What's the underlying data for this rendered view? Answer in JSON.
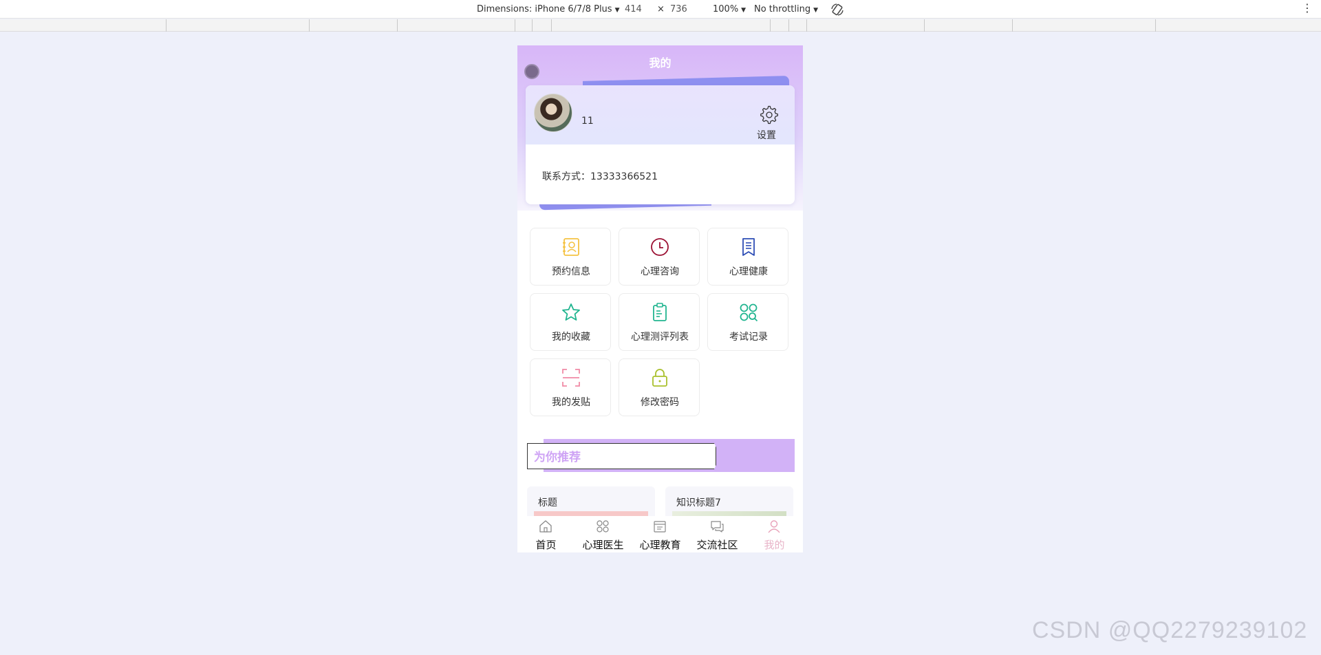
{
  "devtools": {
    "dimensions_label": "Dimensions: iPhone 6/7/8 Plus",
    "width": "414",
    "times": "×",
    "height": "736",
    "zoom": "100%",
    "throttling": "No throttling",
    "rotate_icon": "rotate-icon",
    "more_icon": "kebab-icon"
  },
  "page": {
    "title": "我的"
  },
  "profile": {
    "username": "11",
    "settings_label": "设置",
    "contact_label": "联系方式：13333366521"
  },
  "menu": [
    {
      "label": "预约信息",
      "icon": "contact-book-icon",
      "color": "#f5c242"
    },
    {
      "label": "心理咨询",
      "icon": "clock-icon",
      "color": "#9b1032"
    },
    {
      "label": "心理健康",
      "icon": "bookmark-list-icon",
      "color": "#2d4db5"
    },
    {
      "label": "我的收藏",
      "icon": "star-icon",
      "color": "#22b590"
    },
    {
      "label": "心理测评列表",
      "icon": "clipboard-icon",
      "color": "#22b590"
    },
    {
      "label": "考试记录",
      "icon": "apps-search-icon",
      "color": "#22b590"
    },
    {
      "label": "我的发贴",
      "icon": "scan-icon",
      "color": "#f08aa6"
    },
    {
      "label": "修改密码",
      "icon": "lock-icon",
      "color": "#a9c02d"
    }
  ],
  "recommend": {
    "title": "为你推荐",
    "cards": [
      {
        "title": "标题"
      },
      {
        "title": "知识标题7"
      }
    ]
  },
  "tabbar": [
    {
      "label": "首页",
      "icon": "home-icon"
    },
    {
      "label": "心理医生",
      "icon": "grid-icon"
    },
    {
      "label": "心理教育",
      "icon": "calendar-icon"
    },
    {
      "label": "交流社区",
      "icon": "chat-icon"
    },
    {
      "label": "我的",
      "icon": "user-icon",
      "active": true
    }
  ],
  "watermark": "CSDN @QQ2279239102"
}
